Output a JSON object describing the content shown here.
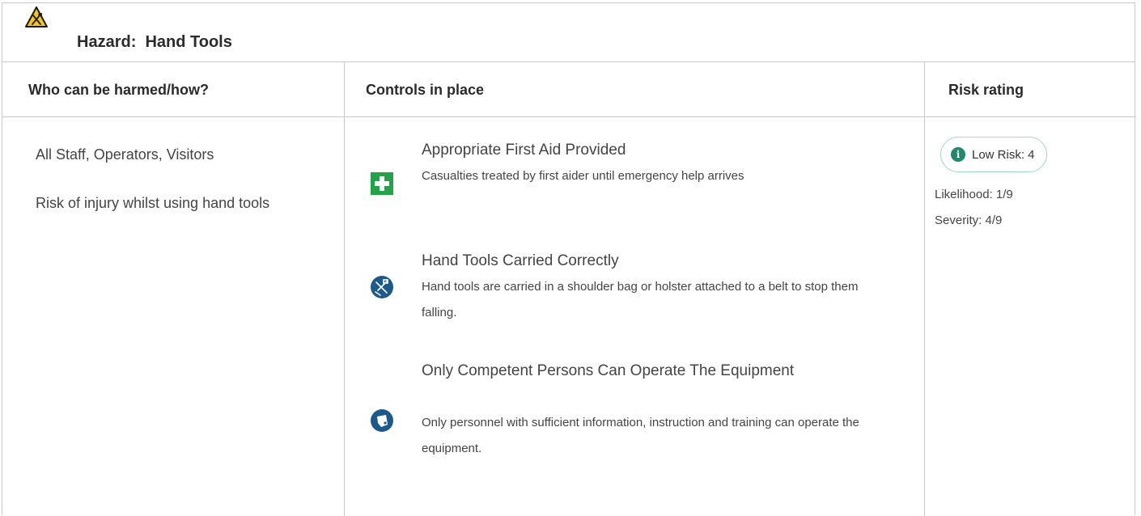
{
  "hazard": {
    "title": "Hazard:  Hand Tools",
    "icon": "hazard-hand-tools-icon"
  },
  "columns": {
    "who": "Who can be harmed/how?",
    "controls": "Controls in place",
    "risk": "Risk rating"
  },
  "who": {
    "people": "All Staff, Operators, Visitors",
    "how": "Risk of injury whilst using hand tools"
  },
  "controls": [
    {
      "title": "Appropriate First Aid Provided",
      "description": "Casualties treated by first aider until emergency help arrives",
      "icon": "first-aid-icon",
      "color": "#22a34a"
    },
    {
      "title": "Hand Tools Carried Correctly",
      "description": "Hand tools are carried in a shoulder bag or holster attached to a belt to stop them falling.",
      "icon": "tool-belt-icon",
      "color": "#1d5a8c"
    },
    {
      "title": "Only Competent Persons Can Operate The Equipment",
      "description": "Only personnel with sufficient information, instruction and training can operate the equipment.",
      "icon": "competence-icon",
      "color": "#1d5a8c"
    }
  ],
  "risk": {
    "badge": "Low Risk: 4",
    "likelihood": "Likelihood: 1/9",
    "severity": "Severity: 4/9",
    "accent": "#1e8a6a"
  }
}
